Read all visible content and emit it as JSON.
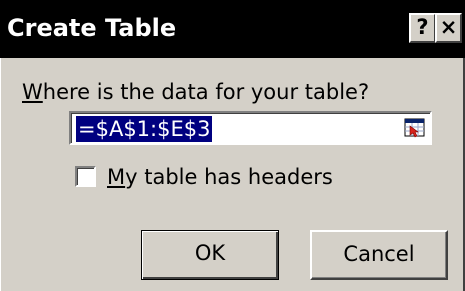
{
  "window": {
    "title": "Create Table",
    "help_label": "?",
    "close_label": "×"
  },
  "prompt": {
    "accel": "W",
    "text": "here is the data for your table?"
  },
  "range": {
    "value": "=$A$1:$E$3",
    "collapse_icon": "range-collapse-icon"
  },
  "headers_checkbox": {
    "accel": "M",
    "text": "y table has headers",
    "checked": false
  },
  "buttons": {
    "ok_label": "OK",
    "cancel_label": "Cancel"
  },
  "colors": {
    "titlebar": "#000000",
    "dialog_face": "#d4d0c8",
    "selection": "#000080"
  }
}
